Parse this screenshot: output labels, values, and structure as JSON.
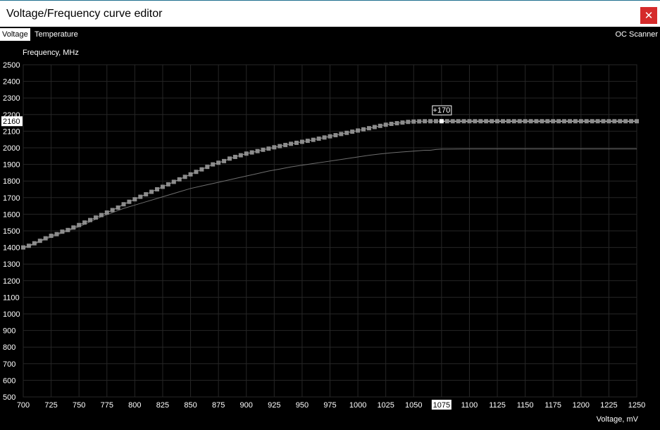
{
  "window": {
    "title": "Voltage/Frequency curve editor",
    "close_icon": "close-icon"
  },
  "tabs": {
    "voltage": "Voltage",
    "temperature": "Temperature",
    "scanner": "OC Scanner"
  },
  "chart_data": {
    "type": "line",
    "ylabel": "Frequency, MHz",
    "xlabel": "Voltage, mV",
    "xlim": [
      700,
      1250
    ],
    "ylim": [
      500,
      2500
    ],
    "x_ticks": [
      700,
      725,
      750,
      775,
      800,
      825,
      850,
      875,
      900,
      925,
      950,
      975,
      1000,
      1025,
      1050,
      1075,
      1100,
      1125,
      1150,
      1175,
      1200,
      1225,
      1250
    ],
    "y_ticks": [
      500,
      600,
      700,
      800,
      900,
      1000,
      1100,
      1200,
      1300,
      1400,
      1500,
      1600,
      1700,
      1800,
      1900,
      2000,
      2100,
      2200,
      2300,
      2400,
      2500
    ],
    "grid": true,
    "highlight": {
      "x_label": "1075",
      "y_label": "2160",
      "offset_label": "+170"
    },
    "series": [
      {
        "role": "edited",
        "x": [
          700,
          705,
          710,
          715,
          720,
          725,
          730,
          735,
          740,
          745,
          750,
          755,
          760,
          765,
          770,
          775,
          780,
          785,
          790,
          795,
          800,
          805,
          810,
          815,
          820,
          825,
          830,
          835,
          840,
          845,
          850,
          855,
          860,
          865,
          870,
          875,
          880,
          885,
          890,
          895,
          900,
          905,
          910,
          915,
          920,
          925,
          930,
          935,
          940,
          945,
          950,
          955,
          960,
          965,
          970,
          975,
          980,
          985,
          990,
          995,
          1000,
          1005,
          1010,
          1015,
          1020,
          1025,
          1030,
          1035,
          1040,
          1045,
          1050,
          1055,
          1060,
          1065,
          1070,
          1075,
          1080,
          1085,
          1090,
          1095,
          1100,
          1105,
          1110,
          1115,
          1120,
          1125,
          1130,
          1135,
          1140,
          1145,
          1150,
          1155,
          1160,
          1165,
          1170,
          1175,
          1180,
          1185,
          1190,
          1195,
          1200,
          1205,
          1210,
          1215,
          1220,
          1225,
          1230,
          1235,
          1240,
          1245,
          1250
        ],
        "y": [
          1400,
          1410,
          1425,
          1440,
          1455,
          1470,
          1480,
          1495,
          1505,
          1520,
          1535,
          1550,
          1565,
          1580,
          1595,
          1610,
          1625,
          1640,
          1660,
          1675,
          1690,
          1705,
          1720,
          1735,
          1750,
          1765,
          1780,
          1795,
          1810,
          1825,
          1840,
          1855,
          1870,
          1885,
          1900,
          1910,
          1920,
          1935,
          1945,
          1955,
          1965,
          1972,
          1980,
          1988,
          1995,
          2003,
          2010,
          2017,
          2024,
          2030,
          2036,
          2042,
          2048,
          2055,
          2062,
          2069,
          2076,
          2083,
          2090,
          2097,
          2104,
          2111,
          2118,
          2125,
          2132,
          2139,
          2144,
          2148,
          2152,
          2156,
          2158,
          2159,
          2160,
          2160,
          2160,
          2160,
          2160,
          2160,
          2160,
          2160,
          2160,
          2160,
          2160,
          2160,
          2160,
          2160,
          2160,
          2160,
          2160,
          2160,
          2160,
          2160,
          2160,
          2160,
          2160,
          2160,
          2160,
          2160,
          2160,
          2160,
          2160,
          2160,
          2160,
          2160,
          2160,
          2160,
          2160,
          2160,
          2160,
          2160,
          2160
        ]
      },
      {
        "role": "default",
        "x": [
          700,
          710,
          720,
          730,
          740,
          750,
          760,
          770,
          780,
          790,
          800,
          810,
          820,
          830,
          840,
          850,
          860,
          870,
          880,
          890,
          900,
          910,
          920,
          930,
          940,
          950,
          960,
          970,
          980,
          990,
          1000,
          1010,
          1020,
          1030,
          1040,
          1050,
          1060,
          1065,
          1070,
          1075,
          1100,
          1150,
          1200,
          1250
        ],
        "y": [
          1395,
          1420,
          1450,
          1475,
          1500,
          1525,
          1555,
          1585,
          1610,
          1635,
          1655,
          1675,
          1695,
          1715,
          1735,
          1755,
          1770,
          1785,
          1800,
          1815,
          1830,
          1845,
          1860,
          1872,
          1885,
          1895,
          1905,
          1915,
          1925,
          1935,
          1945,
          1955,
          1963,
          1970,
          1975,
          1980,
          1985,
          1985,
          1990,
          1992,
          1993,
          1993,
          1993,
          1993
        ]
      }
    ]
  }
}
